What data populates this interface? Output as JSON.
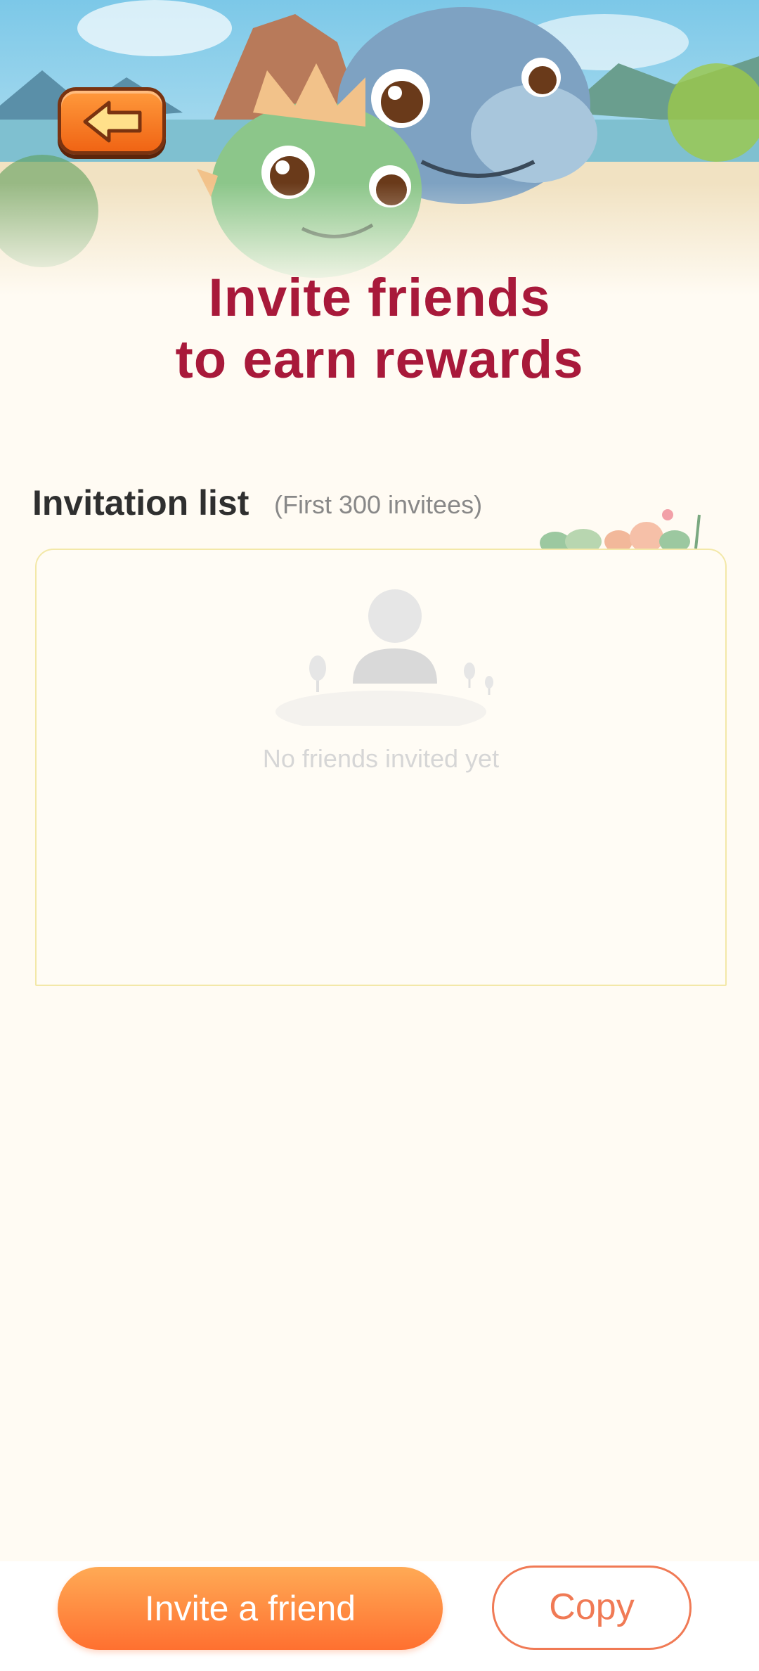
{
  "header": {
    "title_line1": "Invite friends",
    "title_line2": "to earn rewards",
    "back_icon": "arrow-left-icon"
  },
  "invitation_list": {
    "heading": "Invitation list",
    "subheading": "(First 300 invitees)",
    "empty_icon": "person-placeholder-icon",
    "empty_text": "No friends invited yet"
  },
  "actions": {
    "invite_label": "Invite a friend",
    "copy_label": "Copy"
  },
  "colors": {
    "title": "#a8193a",
    "accent": "#ff7030",
    "background": "#fffbf3"
  }
}
